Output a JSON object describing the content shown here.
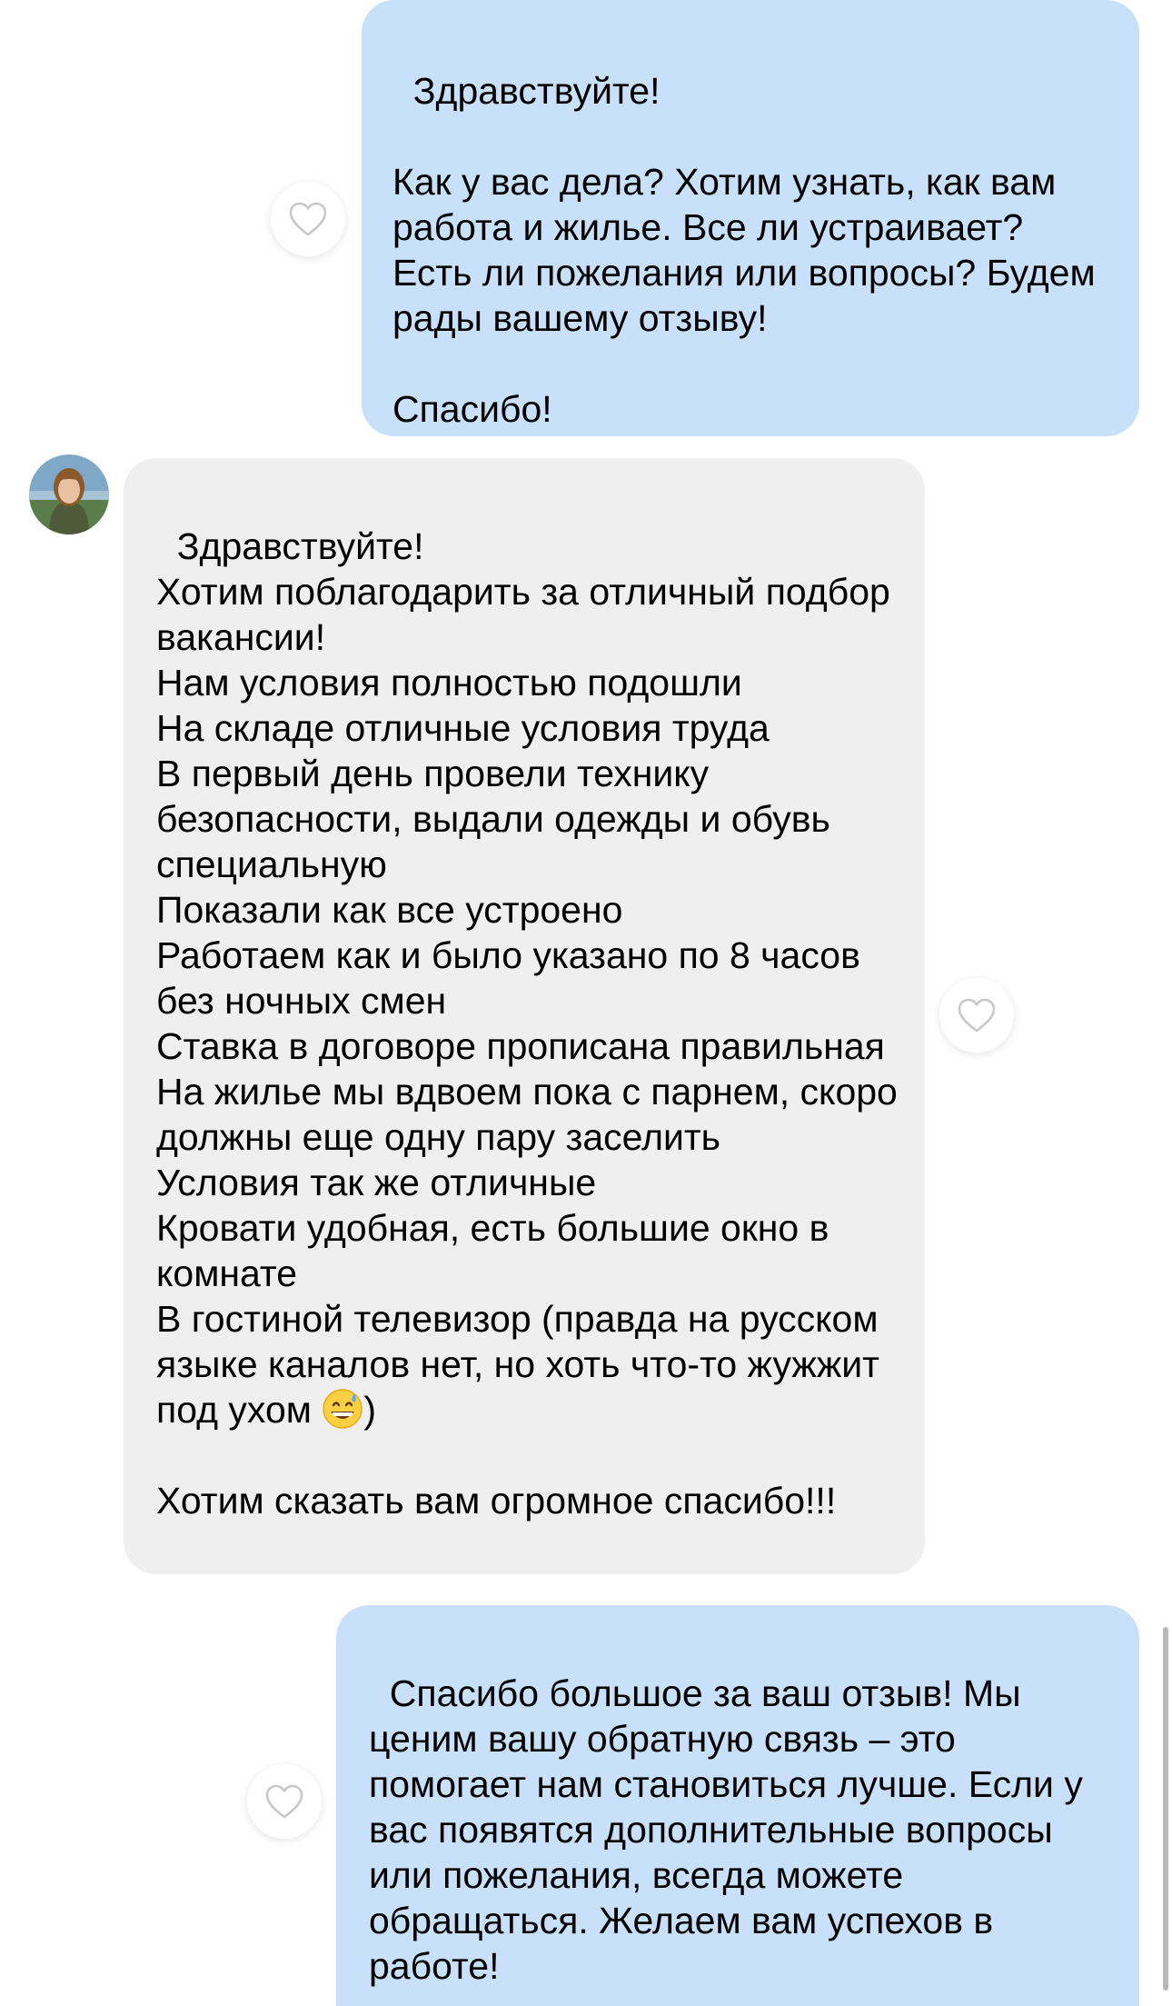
{
  "messages": [
    {
      "id": "m1",
      "direction": "outgoing",
      "text": "Здравствуйте!\n\nКак у вас дела? Хотим узнать, как вам работа и жилье. Все ли устраивает? Есть ли пожелания или вопросы? Будем рады вашему отзыву!\n\nСпасибо!"
    },
    {
      "id": "m2",
      "direction": "incoming",
      "text_before_emoji": "Здравствуйте!\nХотим поблагодарить за отличный подбор вакансии!\nНам условия полностью подошли\nНа складе отличные условия труда\nВ первый день провели технику безопасности, выдали одежды и обувь специальную\nПоказали как все устроено\nРаботаем как и было указано по 8 часов без ночных смен\nСтавка в договоре прописана правильная\nНа жилье мы вдвоем пока с парнем, скоро должны еще одну пару заселить\nУсловия так же отличные\nКровати удобная, есть большие окно в комнате\nВ гостиной телевизор (правда на русском языке каналов нет, но хоть что-то жужжит под ухом ",
      "emoji": "grinning-face-with-sweat",
      "text_after_emoji": ")\n\nХотим сказать вам огромное спасибо!!!"
    },
    {
      "id": "m3",
      "direction": "outgoing",
      "text": "Спасибо большое за ваш отзыв! Мы ценим вашу обратную связь – это помогает нам становиться лучше. Если у вас появятся дополнительные вопросы или пожелания, всегда можете обращаться. Желаем вам успехов в работе!"
    }
  ],
  "icons": {
    "like": "heart-outline-icon",
    "avatar": "user-avatar"
  },
  "colors": {
    "outgoing_bubble": "#c8e0fa",
    "incoming_bubble": "#efefef",
    "icon_stroke": "#c7c7cc"
  }
}
